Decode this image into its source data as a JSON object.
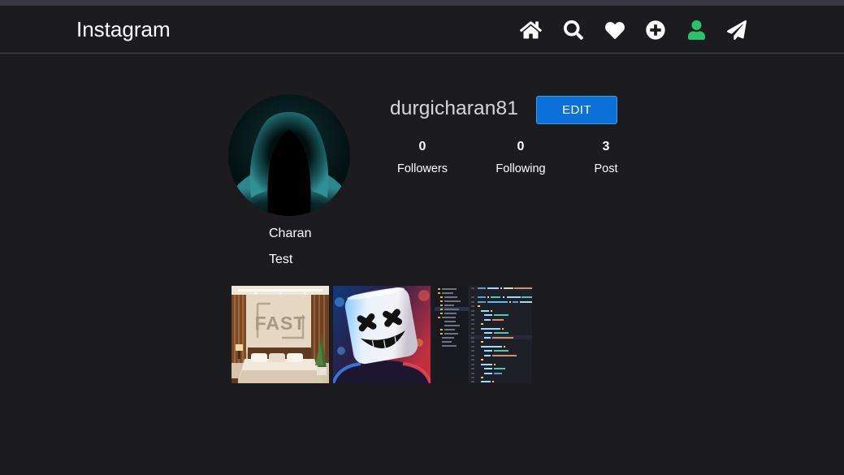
{
  "colors": {
    "page_background": "#1c1b20",
    "top_strip": "#393843",
    "divider": "#4a4950",
    "text": "#ffffff",
    "username_text": "#d6d6d6",
    "edit_button": "#0b71d8",
    "edit_button_border": "#4a95e8",
    "active_icon": "#27c46b"
  },
  "navbar": {
    "brand": "Instagram",
    "icons": [
      {
        "name": "home-icon"
      },
      {
        "name": "search-icon"
      },
      {
        "name": "heart-icon"
      },
      {
        "name": "plus-circle-icon"
      },
      {
        "name": "user-icon",
        "active": true
      },
      {
        "name": "paper-plane-icon"
      }
    ]
  },
  "profile": {
    "username": "durgicharan81",
    "edit_label": "EDIT",
    "full_name": "Charan",
    "bio": "Test",
    "stats": [
      {
        "value": "0",
        "label": "Followers"
      },
      {
        "value": "0",
        "label": "Following"
      },
      {
        "value": "3",
        "label": "Post"
      }
    ]
  },
  "posts": [
    {
      "logo_text": "FAST"
    },
    {},
    {}
  ]
}
